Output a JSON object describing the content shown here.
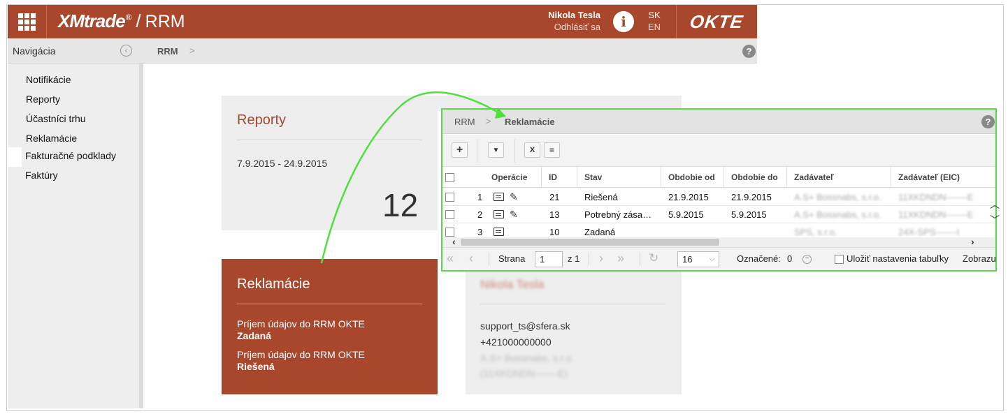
{
  "header": {
    "brand": "XMtrade",
    "brand_reg": "®",
    "slash": "/",
    "app_name": "RRM",
    "user_name": "Nikola Tesla",
    "logout": "Odhlásiť sa",
    "lang_active": "SK",
    "lang_alt": "EN",
    "okte_logo": "OKTE",
    "accent_color": "#a8472b"
  },
  "nav": {
    "title": "Navigácia",
    "collapse_icon": "‹",
    "items": [
      {
        "label": "Notifikácie"
      },
      {
        "label": "Reporty"
      },
      {
        "label": "Účastníci trhu"
      },
      {
        "label": "Reklamácie"
      },
      {
        "label": "Fakturačné podklady"
      },
      {
        "label": "Faktúry"
      }
    ]
  },
  "breadcrumb": {
    "root": "RRM",
    "sep": ">",
    "help": "?"
  },
  "cards": {
    "reporty": {
      "title": "Reporty",
      "date_range": "7.9.2015 - 24.9.2015",
      "count": "12"
    },
    "reklamacie": {
      "title": "Reklamácie",
      "items": [
        {
          "text": "Príjem údajov do RRM OKTE",
          "status": "Zadaná"
        },
        {
          "text": "Príjem údajov do RRM OKTE",
          "status": "Riešená"
        }
      ]
    },
    "contact": {
      "name": "Nikola Tesla",
      "email": "support_ts@sfera.sk",
      "phone": "+421000000000",
      "company": "A.S+ Bossnabs, s.r.o.",
      "eic": "(11XKDNDN-------E)"
    }
  },
  "popup": {
    "crumb_root": "RRM",
    "crumb_sep": ">",
    "crumb_current": "Reklamácie",
    "help": "?",
    "toolbar": {
      "add": "+",
      "filter": "▼",
      "excel": "X",
      "doc": "≡"
    },
    "columns": [
      "Operácie",
      "ID",
      "Stav",
      "Obdobie od",
      "Obdobie do",
      "Zadávateľ",
      "Zadávateľ (EIC)"
    ],
    "rows": [
      {
        "num": "1",
        "id": "21",
        "stav": "Riešená",
        "od": "21.9.2015",
        "do": "21.9.2015",
        "zad": "A.S+ Bossnabs, s.r.o.",
        "eic": "11XKDNDN-------E"
      },
      {
        "num": "2",
        "id": "13",
        "stav": "Potrebný zása…",
        "od": "5.9.2015",
        "do": "5.9.2015",
        "zad": "A.S+ Bossnabs, s.r.o.",
        "eic": "11XKDNDN-------E"
      },
      {
        "num": "3",
        "id": "10",
        "stav": "Zadaná",
        "od": "",
        "do": "",
        "zad": "SPS, s.r.o.",
        "eic": "24X-SPS-------I"
      }
    ],
    "pager": {
      "page_label": "Strana",
      "page_value": "1",
      "of_label": "z 1",
      "page_size": "16",
      "marked_label": "Označené:",
      "marked_count": "0",
      "save_label": "Uložiť nastavenia tabuľky",
      "show_label": "Zobrazu"
    }
  },
  "annotation_color": "#5cd64e"
}
